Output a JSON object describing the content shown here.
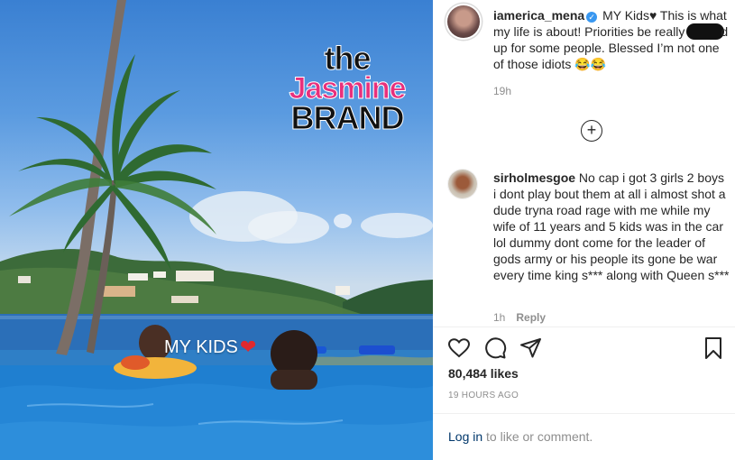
{
  "photo": {
    "watermark": {
      "line1": "the",
      "line2": "Jasmine",
      "line3": "BRAND"
    },
    "sticker_text": "MY KIDS",
    "sticker_heart": "❤"
  },
  "post": {
    "author": {
      "username": "iamerica_mena",
      "verified_icon": "✓"
    },
    "caption": {
      "part1": " MY Kids",
      "heart": "♥",
      "part2": " This is what my life is about! Priorities be really",
      "part3": "d up for some people. Blessed I’m not one of those idiots ",
      "emojis": "😂😂"
    },
    "caption_age": "19h",
    "load_more_symbol": "+"
  },
  "comment": {
    "username": "sirholmesgoe",
    "text": "No cap i got 3 girls 2 boys i dont play bout them at all i almost shot a dude tryna road rage with me while my wife of 11 years and 5 kids was in the car lol dummy dont come for the leader of gods army or his people its gone be war every time king s*** along with Queen s***",
    "age": "1h",
    "reply_label": "Reply"
  },
  "engagement": {
    "likes": "80,484 likes",
    "timestamp": "19 HOURS AGO"
  },
  "footer": {
    "login_link": "Log in",
    "login_suffix": " to like or comment."
  },
  "colors": {
    "link": "#00376b",
    "verified": "#3897f0",
    "muted": "#8e8e8e",
    "watermark_pink": "#e8307c"
  }
}
